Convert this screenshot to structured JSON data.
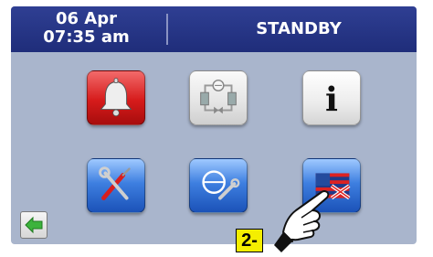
{
  "header": {
    "date": "06 Apr",
    "time": "07:35 am",
    "status": "STANDBY"
  },
  "icons": {
    "alarm": "bell-icon",
    "circuit": "refrigerant-circuit-icon",
    "info": "info-icon",
    "info_glyph": "i",
    "tools": "tools-icon",
    "service": "compressor-wrench-icon",
    "language": "language-flag-icon",
    "back": "back-arrow-icon"
  },
  "annotation": {
    "step_label": "2-"
  },
  "colors": {
    "header": "#2f3f93",
    "screen_bg": "#a9b5cc",
    "accent_red": "#d61b1b",
    "accent_blue": "#3e7fe0",
    "step_yellow": "#f4ee00"
  }
}
